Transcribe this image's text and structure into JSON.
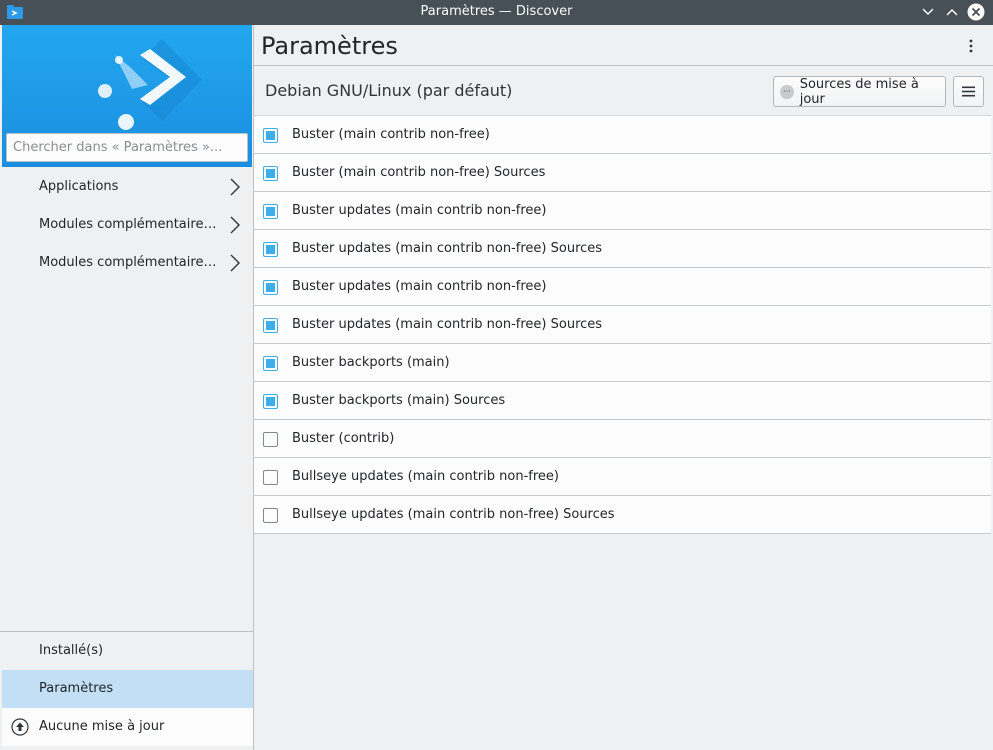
{
  "window": {
    "title": "Paramètres — Discover"
  },
  "sidebar": {
    "search_placeholder": "Chercher dans « Paramètres »...",
    "categories": [
      {
        "label": "Applications"
      },
      {
        "label": "Modules complémentaires ..."
      },
      {
        "label": "Modules complémentaires ..."
      }
    ],
    "bottom": {
      "installed": "Installé(s)",
      "settings": "Paramètres",
      "updates": "Aucune mise à jour"
    }
  },
  "main": {
    "title": "Paramètres",
    "source_name": "Debian GNU/Linux (par défaut)",
    "update_sources_button": "Sources de mise à jour",
    "repositories": [
      {
        "label": "Buster (main contrib non-free)",
        "checked": true
      },
      {
        "label": "Buster (main contrib non-free) Sources",
        "checked": true
      },
      {
        "label": "Buster updates (main contrib non-free)",
        "checked": true
      },
      {
        "label": "Buster updates (main contrib non-free) Sources",
        "checked": true
      },
      {
        "label": "Buster updates (main contrib non-free)",
        "checked": true
      },
      {
        "label": "Buster updates (main contrib non-free) Sources",
        "checked": true
      },
      {
        "label": "Buster backports (main)",
        "checked": true
      },
      {
        "label": "Buster backports (main) Sources",
        "checked": true
      },
      {
        "label": "Buster (contrib)",
        "checked": false
      },
      {
        "label": "Bullseye updates (main contrib non-free)",
        "checked": false
      },
      {
        "label": "Bullseye updates (main contrib non-free) Sources",
        "checked": false
      }
    ]
  },
  "colors": {
    "accent": "#3daee9",
    "titlebar": "#475057",
    "selection": "#c2dff5",
    "banner": "#1d99e6"
  }
}
